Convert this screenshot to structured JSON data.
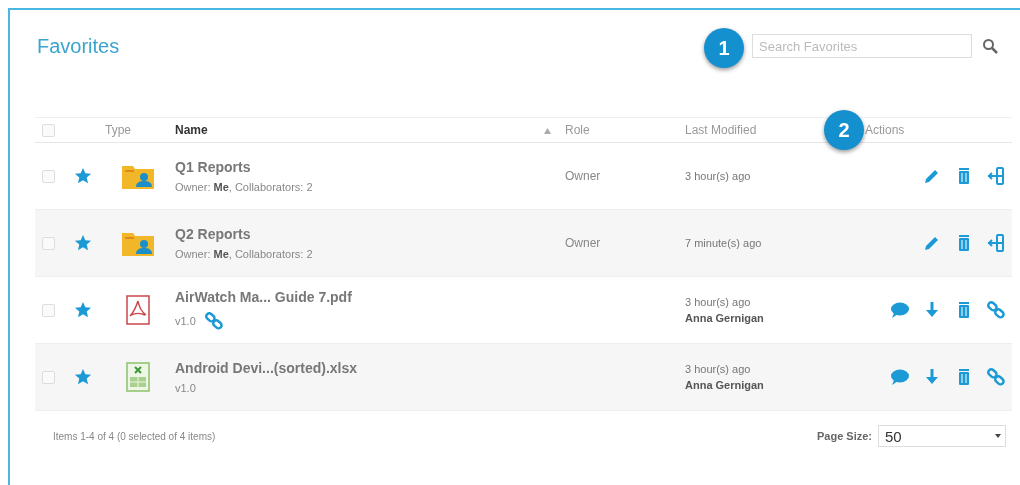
{
  "title": "Favorites",
  "search": {
    "placeholder": "Search Favorites"
  },
  "callouts": [
    {
      "number": "1",
      "kind": "search"
    },
    {
      "number": "2",
      "kind": "actions"
    }
  ],
  "table": {
    "select_all": {
      "checked": false
    },
    "columns": [
      {
        "label": "Type",
        "kind": "type"
      },
      {
        "label": "Name",
        "kind": "name",
        "sorted": true
      },
      {
        "label": "Role",
        "kind": "role"
      },
      {
        "label": "Last Modified",
        "kind": "modified"
      },
      {
        "label": "Actions",
        "kind": "actions"
      }
    ],
    "rows": [
      {
        "checked": false,
        "starred": true,
        "kind": "folder",
        "name": "Q1 Reports",
        "subtitle": "Owner: **Me**, Collaborators: 2",
        "role": "Owner",
        "modified": "3 hour(s) ago",
        "actions": [
          {
            "kind": "edit"
          },
          {
            "kind": "delete"
          },
          {
            "kind": "share"
          }
        ]
      },
      {
        "checked": false,
        "starred": true,
        "kind": "folder",
        "name": "Q2 Reports",
        "subtitle": "Owner: **Me**, Collaborators: 2",
        "role": "Owner",
        "modified": "7 minute(s) ago",
        "actions": [
          {
            "kind": "edit"
          },
          {
            "kind": "delete"
          },
          {
            "kind": "share"
          }
        ]
      },
      {
        "checked": false,
        "starred": true,
        "kind": "pdf",
        "name": "AirWatch Ma... Guide 7.pdf",
        "subtitle": "v1.0",
        "linked": true,
        "modified": "3 hour(s) ago",
        "modified_by": "Anna Gernigan",
        "actions": [
          {
            "kind": "comment"
          },
          {
            "kind": "download"
          },
          {
            "kind": "delete"
          },
          {
            "kind": "link"
          }
        ]
      },
      {
        "checked": false,
        "starred": true,
        "kind": "xlsx",
        "name": "Android Devi...(sorted).xlsx",
        "subtitle": "v1.0",
        "linked": false,
        "modified": "3 hour(s) ago",
        "modified_by": "Anna Gernigan",
        "actions": [
          {
            "kind": "comment"
          },
          {
            "kind": "download"
          },
          {
            "kind": "delete"
          },
          {
            "kind": "link"
          }
        ]
      }
    ]
  },
  "footer": {
    "summary": "Items 1-4 of 4 (0 selected of 4 items)",
    "page_size_label": "Page Size:",
    "page_size": "50"
  }
}
